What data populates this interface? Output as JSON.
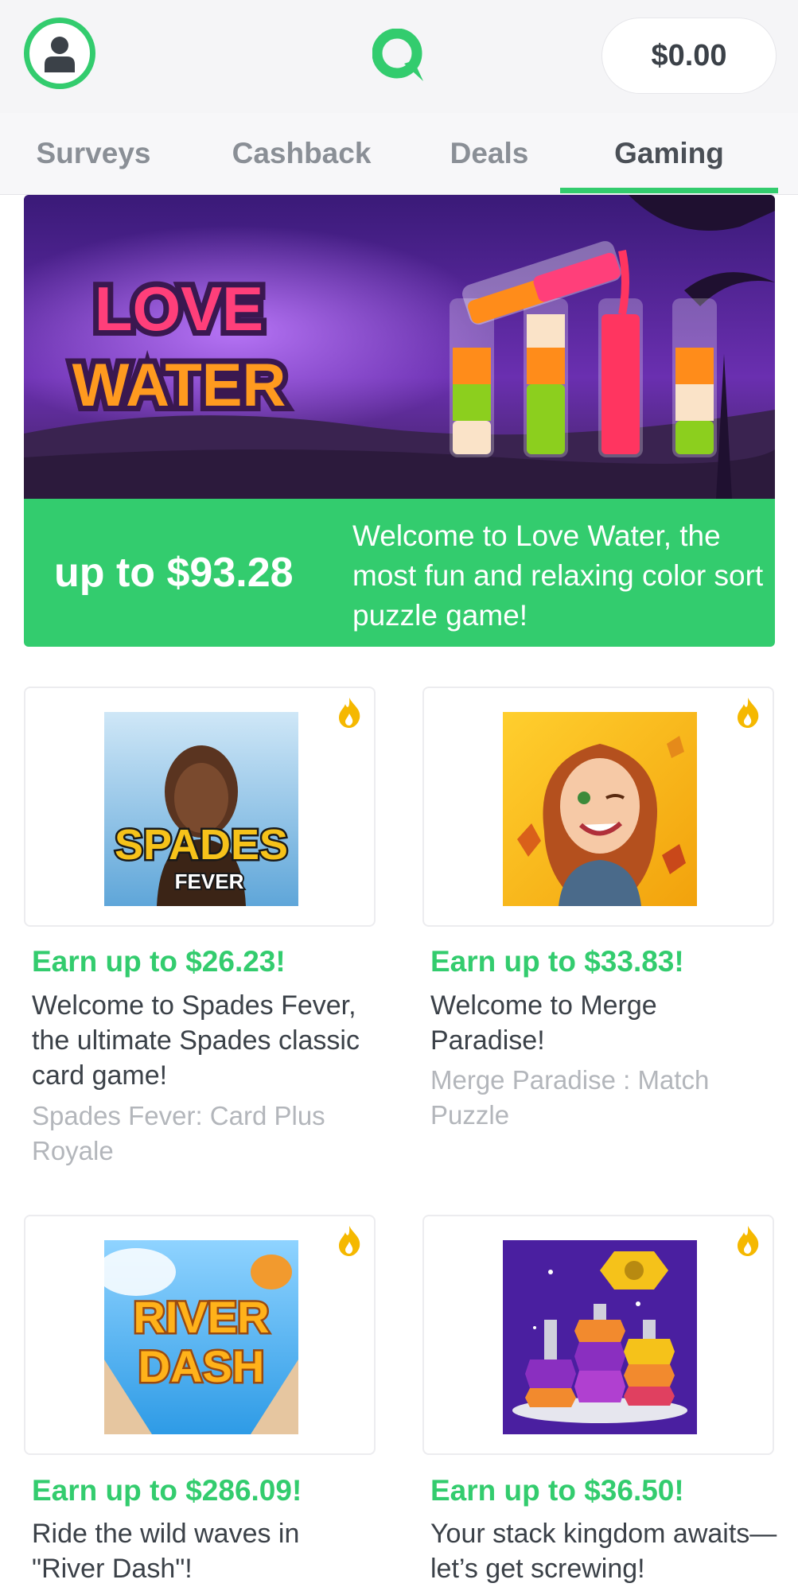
{
  "header": {
    "avatar_icon": "user-icon",
    "logo_icon": "chat-logo-icon",
    "balance": "$0.00",
    "accent": "#33cc6e"
  },
  "tabs": [
    {
      "label": "Surveys"
    },
    {
      "label": "Cashback"
    },
    {
      "label": "Deals"
    },
    {
      "label": "Gaming",
      "active": true
    }
  ],
  "hero": {
    "game_logo_line1": "LOVE",
    "game_logo_line2": "WATER",
    "amount": "up to $93.28",
    "description": "Welcome to Love Water, the most fun and relaxing color sort puzzle game!"
  },
  "offers": [
    {
      "earn": "Earn up to $26.23!",
      "description": "Welcome to Spades Fever, the ultimate Spades classic card game!",
      "title": "Spades Fever: Card Plus Royale",
      "logo_line1": "SPADES",
      "logo_line2": "FEVER",
      "hot_icon": "fire-icon"
    },
    {
      "earn": "Earn up to $33.83!",
      "description": "Welcome to Merge Paradise!",
      "title": "Merge Paradise : Match Puzzle",
      "hot_icon": "fire-icon"
    },
    {
      "earn": "Earn up to $286.09!",
      "description": "Ride the wild waves in \"River Dash\"!",
      "title": "",
      "logo_line1": "RIVER",
      "logo_line2": "DASH",
      "hot_icon": "fire-icon"
    },
    {
      "earn": "Earn up to $36.50!",
      "description": "Your stack kingdom awaits—let’s get screwing!",
      "title": "",
      "hot_icon": "fire-icon"
    }
  ]
}
